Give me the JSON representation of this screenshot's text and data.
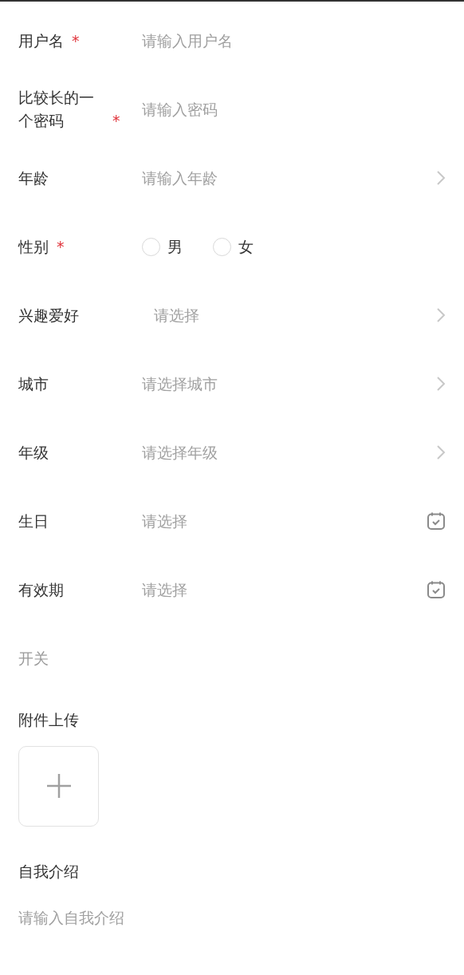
{
  "fields": [
    {
      "kind": "input",
      "label": "用户名",
      "required_mark": "*",
      "placeholder": "请输入用户名"
    },
    {
      "kind": "input",
      "label": "比较长的一个密码",
      "required_mark": "*",
      "placeholder": "请输入密码"
    },
    {
      "kind": "arrow",
      "label": "年龄",
      "placeholder": "请输入年龄"
    },
    {
      "kind": "radio",
      "label": "性别",
      "required_mark": "*",
      "options": [
        {
          "label": "男",
          "selected": false
        },
        {
          "label": "女",
          "selected": false
        }
      ]
    },
    {
      "kind": "select",
      "label": "兴趣爱好",
      "placeholder": "请选择"
    },
    {
      "kind": "arrow",
      "label": "城市",
      "placeholder": "请选择城市"
    },
    {
      "kind": "arrow",
      "label": "年级",
      "placeholder": "请选择年级"
    },
    {
      "kind": "date",
      "label": "生日",
      "placeholder": "请选择"
    },
    {
      "kind": "date",
      "label": "有效期",
      "placeholder": "请选择"
    },
    {
      "kind": "switch",
      "label": "开关",
      "disabled": true
    }
  ],
  "upload": {
    "label": "附件上传"
  },
  "intro": {
    "label": "自我介绍",
    "placeholder": "请输入自我介绍"
  }
}
